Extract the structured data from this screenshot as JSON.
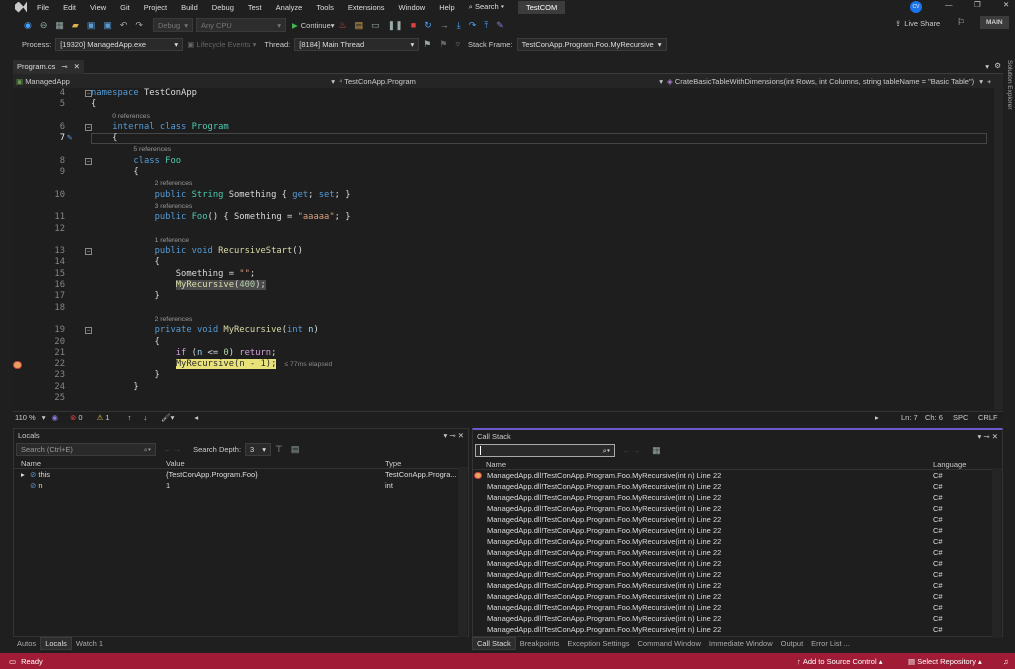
{
  "menu": {
    "items": [
      "File",
      "Edit",
      "View",
      "Git",
      "Project",
      "Build",
      "Debug",
      "Test",
      "Analyze",
      "Tools",
      "Extensions",
      "Window",
      "Help"
    ],
    "search": "Search",
    "solution": "TestCOM",
    "avatar": "CV"
  },
  "toolbar": {
    "config": "Debug",
    "platform": "Any CPU",
    "continue": "Continue",
    "live_share": "Live Share",
    "main": "MAIN"
  },
  "debug_location": {
    "process_label": "Process:",
    "process": "[19320] ManagedApp.exe",
    "lifecycle": "Lifecycle Events",
    "thread_label": "Thread:",
    "thread": "[8184] Main Thread",
    "stack_frame_label": "Stack Frame:",
    "stack_frame": "TestConApp.Program.Foo.MyRecursive"
  },
  "doc_tab": {
    "name": "Program.cs"
  },
  "solution_explorer": "Solution Explorer",
  "navbar": {
    "project": "ManagedApp",
    "class": "TestConApp.Program",
    "member": "CrateBasicTableWithDimensions(int Rows, int Columns, string tableName = \"Basic Table\")"
  },
  "code": [
    {
      "n": "4",
      "t": [
        [
          "namespace",
          "kw"
        ],
        [
          " TestConApp",
          "pl"
        ]
      ],
      "fold": true
    },
    {
      "n": "5",
      "t": [
        [
          "{",
          "pl"
        ]
      ]
    },
    {
      "lens": "0 references"
    },
    {
      "n": "6",
      "t": [
        [
          "    ",
          "pl"
        ],
        [
          "internal",
          "kw"
        ],
        [
          " ",
          "pl"
        ],
        [
          "class",
          "kw"
        ],
        [
          " ",
          "pl"
        ],
        [
          "Program",
          "ty"
        ]
      ],
      "fold": true
    },
    {
      "n": "7",
      "t": [
        [
          "    {",
          "pl"
        ]
      ],
      "current": true
    },
    {
      "lens": "5 references"
    },
    {
      "n": "8",
      "t": [
        [
          "        ",
          "pl"
        ],
        [
          "class",
          "kw"
        ],
        [
          " ",
          "pl"
        ],
        [
          "Foo",
          "ty"
        ]
      ],
      "fold": true
    },
    {
      "n": "9",
      "t": [
        [
          "        {",
          "pl"
        ]
      ]
    },
    {
      "lens": "2 references"
    },
    {
      "n": "10",
      "t": [
        [
          "            ",
          "pl"
        ],
        [
          "public",
          "kw"
        ],
        [
          " ",
          "pl"
        ],
        [
          "String",
          "ty"
        ],
        [
          " Something { ",
          "pl"
        ],
        [
          "get",
          "kw"
        ],
        [
          "; ",
          "pl"
        ],
        [
          "set",
          "kw"
        ],
        [
          "; }",
          "pl"
        ]
      ]
    },
    {
      "lens": "3 references"
    },
    {
      "n": "11",
      "t": [
        [
          "            ",
          "pl"
        ],
        [
          "public",
          "kw"
        ],
        [
          " ",
          "pl"
        ],
        [
          "Foo",
          "ty"
        ],
        [
          "() { Something = ",
          "pl"
        ],
        [
          "\"aaaaa\"",
          "st"
        ],
        [
          "; }",
          "pl"
        ]
      ]
    },
    {
      "n": "12",
      "t": []
    },
    {
      "lens": "1 reference"
    },
    {
      "n": "13",
      "t": [
        [
          "            ",
          "pl"
        ],
        [
          "public",
          "kw"
        ],
        [
          " ",
          "pl"
        ],
        [
          "void",
          "kw"
        ],
        [
          " ",
          "pl"
        ],
        [
          "RecursiveStart",
          "fn"
        ],
        [
          "()",
          "pl"
        ]
      ],
      "fold": true
    },
    {
      "n": "14",
      "t": [
        [
          "            {",
          "pl"
        ]
      ]
    },
    {
      "n": "15",
      "t": [
        [
          "                Something = ",
          "pl"
        ],
        [
          "\"\"",
          "st"
        ],
        [
          ";",
          "pl"
        ]
      ]
    },
    {
      "n": "16",
      "t": [
        [
          "                ",
          "pl"
        ],
        [
          "MyRecursive",
          "fn"
        ],
        [
          "(",
          "pl"
        ],
        [
          "400",
          "nm"
        ],
        [
          ");",
          "pl"
        ]
      ],
      "hl": "gray"
    },
    {
      "n": "17",
      "t": [
        [
          "            }",
          "pl"
        ]
      ]
    },
    {
      "n": "18",
      "t": []
    },
    {
      "lens": "2 references"
    },
    {
      "n": "19",
      "t": [
        [
          "            ",
          "pl"
        ],
        [
          "private",
          "kw"
        ],
        [
          " ",
          "pl"
        ],
        [
          "void",
          "kw"
        ],
        [
          " ",
          "pl"
        ],
        [
          "MyRecursive",
          "fn"
        ],
        [
          "(",
          "pl"
        ],
        [
          "int",
          "kw"
        ],
        [
          " ",
          "pl"
        ],
        [
          "n",
          "pa"
        ],
        [
          ")",
          "pl"
        ]
      ],
      "fold": true
    },
    {
      "n": "20",
      "t": [
        [
          "            {",
          "pl"
        ]
      ]
    },
    {
      "n": "21",
      "t": [
        [
          "                ",
          "pl"
        ],
        [
          "if",
          "ctl"
        ],
        [
          " (",
          "pl"
        ],
        [
          "n",
          "pa"
        ],
        [
          " <= ",
          "pl"
        ],
        [
          "0",
          "nm"
        ],
        [
          ") ",
          "pl"
        ],
        [
          "return",
          "ctl"
        ],
        [
          ";",
          "pl"
        ]
      ]
    },
    {
      "n": "22",
      "t": [
        [
          "                ",
          "pl"
        ],
        [
          "MyRecursive",
          "fn"
        ],
        [
          "(",
          "pl"
        ],
        [
          "n",
          "pa"
        ],
        [
          " - ",
          "pl"
        ],
        [
          "1",
          "nm"
        ],
        [
          ");",
          "pl"
        ]
      ],
      "hl": "yellow",
      "elapsed": "≤ 77ms elapsed",
      "breakpoint": true
    },
    {
      "n": "23",
      "t": [
        [
          "            }",
          "pl"
        ]
      ]
    },
    {
      "n": "24",
      "t": [
        [
          "        }",
          "pl"
        ]
      ]
    },
    {
      "n": "25",
      "t": []
    }
  ],
  "editor_status": {
    "zoom": "110 %",
    "errors": "0",
    "warnings": "1",
    "line": "Ln: 7",
    "col": "Ch: 6",
    "spc": "SPC",
    "eol": "CRLF"
  },
  "locals": {
    "title": "Locals",
    "search_placeholder": "Search (Ctrl+E)",
    "depth_label": "Search Depth:",
    "depth": "3",
    "columns": [
      "Name",
      "Value",
      "Type"
    ],
    "rows": [
      {
        "name": "this",
        "value": "{TestConApp.Program.Foo}",
        "type": "TestConApp.Progra...",
        "expandable": true
      },
      {
        "name": "n",
        "value": "1",
        "type": "int"
      }
    ],
    "tabs": [
      "Autos",
      "Locals",
      "Watch 1"
    ],
    "active_tab": "Locals"
  },
  "callstack": {
    "title": "Call Stack",
    "columns": [
      "Name",
      "Language"
    ],
    "rows": [
      {
        "name": "ManagedApp.dll!TestConApp.Program.Foo.MyRecursive(int n) Line 22",
        "lang": "C#"
      },
      {
        "name": "ManagedApp.dll!TestConApp.Program.Foo.MyRecursive(int n) Line 22",
        "lang": "C#"
      },
      {
        "name": "ManagedApp.dll!TestConApp.Program.Foo.MyRecursive(int n) Line 22",
        "lang": "C#"
      },
      {
        "name": "ManagedApp.dll!TestConApp.Program.Foo.MyRecursive(int n) Line 22",
        "lang": "C#"
      },
      {
        "name": "ManagedApp.dll!TestConApp.Program.Foo.MyRecursive(int n) Line 22",
        "lang": "C#"
      },
      {
        "name": "ManagedApp.dll!TestConApp.Program.Foo.MyRecursive(int n) Line 22",
        "lang": "C#"
      },
      {
        "name": "ManagedApp.dll!TestConApp.Program.Foo.MyRecursive(int n) Line 22",
        "lang": "C#"
      },
      {
        "name": "ManagedApp.dll!TestConApp.Program.Foo.MyRecursive(int n) Line 22",
        "lang": "C#"
      },
      {
        "name": "ManagedApp.dll!TestConApp.Program.Foo.MyRecursive(int n) Line 22",
        "lang": "C#"
      },
      {
        "name": "ManagedApp.dll!TestConApp.Program.Foo.MyRecursive(int n) Line 22",
        "lang": "C#"
      },
      {
        "name": "ManagedApp.dll!TestConApp.Program.Foo.MyRecursive(int n) Line 22",
        "lang": "C#"
      },
      {
        "name": "ManagedApp.dll!TestConApp.Program.Foo.MyRecursive(int n) Line 22",
        "lang": "C#"
      },
      {
        "name": "ManagedApp.dll!TestConApp.Program.Foo.MyRecursive(int n) Line 22",
        "lang": "C#"
      },
      {
        "name": "ManagedApp.dll!TestConApp.Program.Foo.MyRecursive(int n) Line 22",
        "lang": "C#"
      },
      {
        "name": "ManagedApp.dll!TestConApp.Program.Foo.MyRecursive(int n) Line 22",
        "lang": "C#"
      }
    ],
    "tabs": [
      "Call Stack",
      "Breakpoints",
      "Exception Settings",
      "Command Window",
      "Immediate Window",
      "Output",
      "Error List ..."
    ],
    "active_tab": "Call Stack"
  },
  "statusbar": {
    "ready": "Ready",
    "add_source": "Add to Source Control",
    "select_repo": "Select Repository",
    "color": "#a01c36"
  }
}
